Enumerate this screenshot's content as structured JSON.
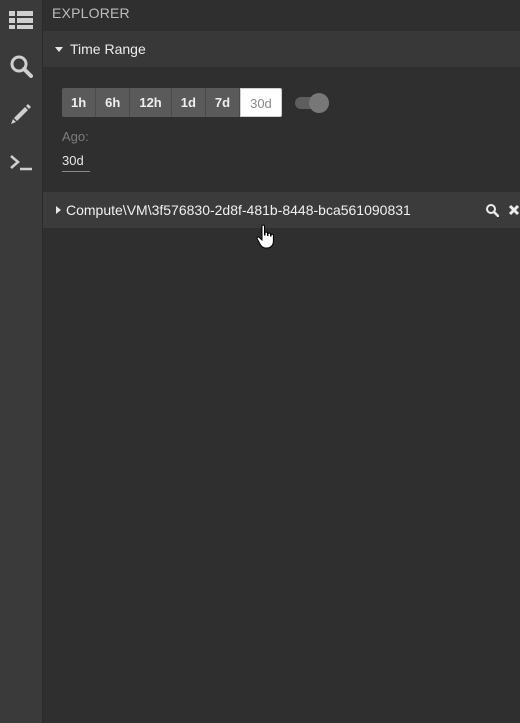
{
  "sidebar": {
    "items": [
      {
        "icon": "list-icon"
      },
      {
        "icon": "search-icon"
      },
      {
        "icon": "pencil-icon"
      },
      {
        "icon": "terminal-icon"
      }
    ]
  },
  "explorer": {
    "title": "EXPLORER",
    "time_range": {
      "header": "Time Range",
      "buttons": [
        "1h",
        "6h",
        "12h",
        "1d",
        "7d",
        "30d"
      ],
      "active": "30d",
      "ago_label": "Ago:",
      "ago_value": "30d"
    },
    "tree": {
      "item_label": "Compute\\VM\\3f576830-2d8f-481b-8448-bca561090831",
      "search_icon": "search-icon",
      "close_icon": "close-icon"
    }
  },
  "colors": {
    "background": "#2f2f2f",
    "sidebar": "#3a3a3a",
    "section_header": "#383838",
    "button": "#5a5a5a",
    "active_button": "#ffffff"
  }
}
